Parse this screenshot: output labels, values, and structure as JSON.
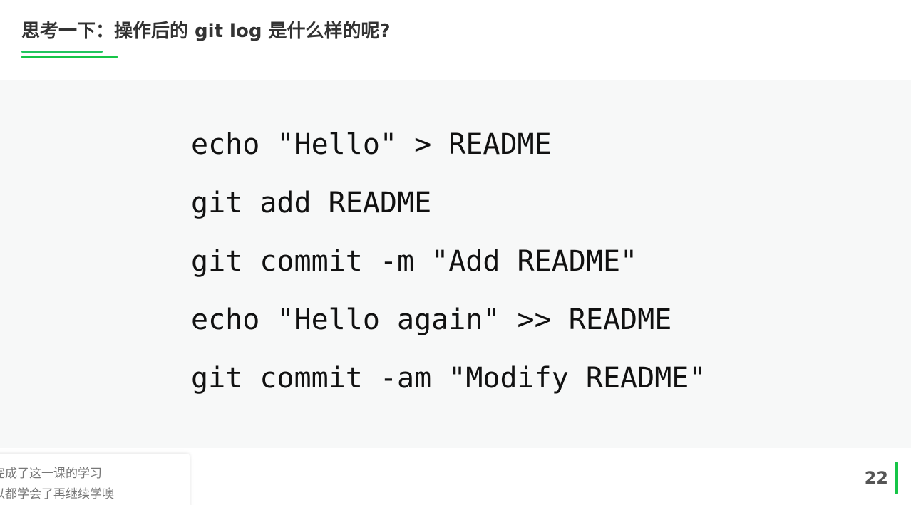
{
  "slide": {
    "title": "思考一下：操作后的 git log 是什么样的呢?",
    "code_lines": [
      "echo \"Hello\" > README",
      "git add README",
      "git commit -m \"Add README\"",
      "echo \"Hello again\" >> README",
      "git commit -am \"Modify README\""
    ],
    "page_number": "22"
  },
  "toast": {
    "line1": "完成了这一课的学习",
    "line2": "以都学会了再继续学噢"
  },
  "colors": {
    "accent": "#16c547",
    "code_background": "#f7f8f8",
    "title_text": "#333333"
  }
}
